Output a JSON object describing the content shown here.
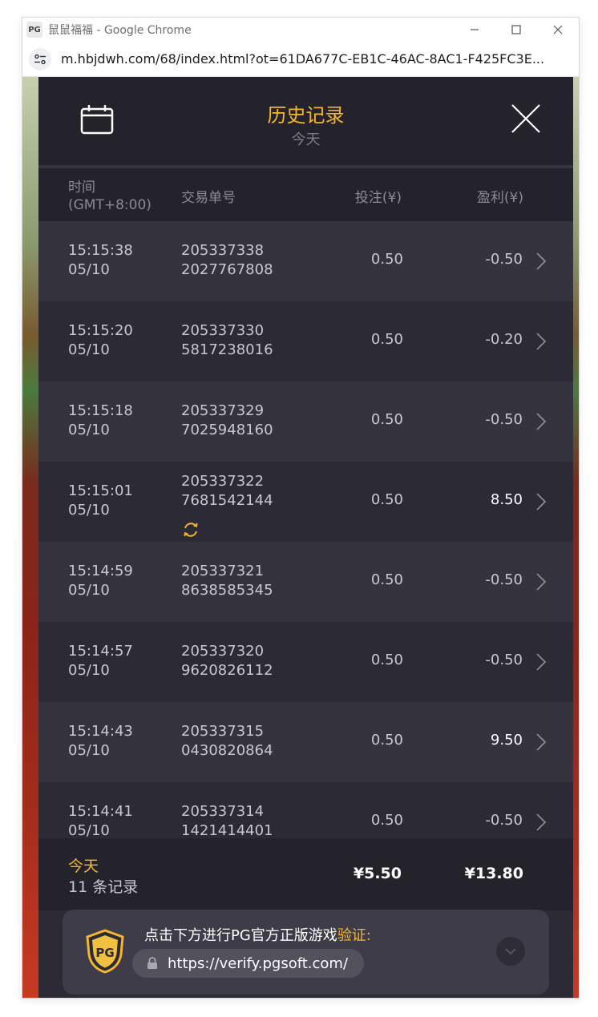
{
  "browser": {
    "window_title": "鼠鼠福福 - Google Chrome",
    "url": "m.hbjdwh.com/68/index.html?ot=61DA677C-EB1C-46AC-8AC1-F425FC3E..."
  },
  "header": {
    "title": "历史记录",
    "subtitle": "今天"
  },
  "columns": {
    "time": "时间",
    "time_zone": "(GMT+8:00)",
    "txn": "交易单号",
    "bet": "投注(¥)",
    "profit": "盈利(¥)"
  },
  "records": [
    {
      "time": "15:15:38",
      "date": "05/10",
      "txn1": "205337338",
      "txn2": "2027767808",
      "bet": "0.50",
      "profit": "-0.50"
    },
    {
      "time": "15:15:20",
      "date": "05/10",
      "txn1": "205337330",
      "txn2": "5817238016",
      "bet": "0.50",
      "profit": "-0.20"
    },
    {
      "time": "15:15:18",
      "date": "05/10",
      "txn1": "205337329",
      "txn2": "7025948160",
      "bet": "0.50",
      "profit": "-0.50"
    },
    {
      "time": "15:15:01",
      "date": "05/10",
      "txn1": "205337322",
      "txn2": "7681542144",
      "bet": "0.50",
      "profit": "8.50"
    },
    {
      "time": "15:14:59",
      "date": "05/10",
      "txn1": "205337321",
      "txn2": "8638585345",
      "bet": "0.50",
      "profit": "-0.50"
    },
    {
      "time": "15:14:57",
      "date": "05/10",
      "txn1": "205337320",
      "txn2": "9620826112",
      "bet": "0.50",
      "profit": "-0.50"
    },
    {
      "time": "15:14:43",
      "date": "05/10",
      "txn1": "205337315",
      "txn2": "0430820864",
      "bet": "0.50",
      "profit": "9.50"
    },
    {
      "time": "15:14:41",
      "date": "05/10",
      "txn1": "205337314",
      "txn2": "1421414401",
      "bet": "0.50",
      "profit": "-0.50"
    }
  ],
  "footer": {
    "period": "今天",
    "count": "11 条记录",
    "total_bet": "¥5.50",
    "total_profit": "¥13.80"
  },
  "verify": {
    "text": "点击下方进行PG官方正版游戏",
    "highlight": "验证:",
    "url": "https://verify.pgsoft.com/"
  },
  "colors": {
    "accent": "#f7b52c",
    "panel_bg": "#2b2a35",
    "row_alt_bg": "#34333e"
  }
}
